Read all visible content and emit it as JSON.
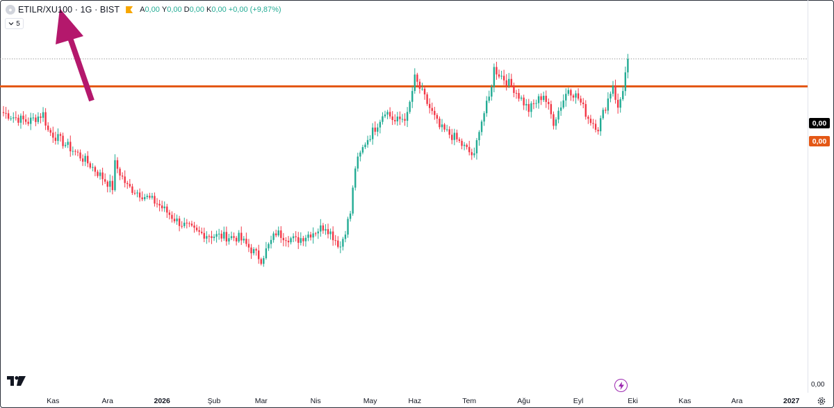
{
  "header": {
    "symbol_title": "ETILR/XU100 · 1G · BIST",
    "ohlc": [
      {
        "key": "A",
        "value": "0,00"
      },
      {
        "key": "Y",
        "value": "0,00"
      },
      {
        "key": "D",
        "value": "0,00"
      },
      {
        "key": "K",
        "value": "0,00"
      }
    ],
    "change": "+0,00 (+9,87%)",
    "indicator_toggle_count": "5"
  },
  "price_scale": {
    "last_price_label": "0,00",
    "hline_label": "0,00",
    "axis_bottom_label": "0,00"
  },
  "colors": {
    "up": "#22ab94",
    "down": "#f23645",
    "hline": "#e45816",
    "arrow": "#b4186c",
    "last_price_tag": "#000000"
  },
  "icons": [
    "tradingview-logo-icon",
    "lightning-bolt-icon",
    "gear-icon",
    "symbol-logo-icon",
    "flag-icon",
    "chevron-down-icon"
  ],
  "chart_data": {
    "type": "candlestick",
    "title": "ETILR/XU100 · 1G · BIST",
    "x_ticks": [
      {
        "label": "Kas",
        "index": 20,
        "bold": false
      },
      {
        "label": "Ara",
        "index": 42,
        "bold": false
      },
      {
        "label": "2026",
        "index": 64,
        "bold": true
      },
      {
        "label": "Şub",
        "index": 85,
        "bold": false
      },
      {
        "label": "Mar",
        "index": 104,
        "bold": false
      },
      {
        "label": "Nis",
        "index": 126,
        "bold": false
      },
      {
        "label": "May",
        "index": 148,
        "bold": false
      },
      {
        "label": "Haz",
        "index": 166,
        "bold": false
      },
      {
        "label": "Tem",
        "index": 188,
        "bold": false
      },
      {
        "label": "Ağu",
        "index": 210,
        "bold": false
      },
      {
        "label": "Eyl",
        "index": 232,
        "bold": false
      },
      {
        "label": "Eki",
        "index": 254,
        "bold": false
      },
      {
        "label": "Kas",
        "index": 275,
        "bold": false
      },
      {
        "label": "Ara",
        "index": 296,
        "bold": false
      },
      {
        "label": "2027",
        "index": 318,
        "bold": true
      }
    ],
    "horizontal_line": {
      "label": "0,00"
    },
    "last_price": {
      "label": "0,00"
    },
    "ylim": [
      0.0,
      0.4
    ],
    "anchors": [
      [
        0,
        0.285
      ],
      [
        5,
        0.28
      ],
      [
        10,
        0.276
      ],
      [
        16,
        0.284
      ],
      [
        18,
        0.267
      ],
      [
        25,
        0.253
      ],
      [
        30,
        0.243
      ],
      [
        35,
        0.232
      ],
      [
        40,
        0.219
      ],
      [
        44,
        0.209
      ],
      [
        45,
        0.233
      ],
      [
        50,
        0.21
      ],
      [
        55,
        0.203
      ],
      [
        62,
        0.193
      ],
      [
        70,
        0.175
      ],
      [
        78,
        0.163
      ],
      [
        85,
        0.16
      ],
      [
        95,
        0.158
      ],
      [
        104,
        0.136
      ],
      [
        110,
        0.163
      ],
      [
        118,
        0.155
      ],
      [
        126,
        0.165
      ],
      [
        130,
        0.17
      ],
      [
        136,
        0.149
      ],
      [
        140,
        0.183
      ],
      [
        142,
        0.23
      ],
      [
        146,
        0.255
      ],
      [
        150,
        0.27
      ],
      [
        154,
        0.288
      ],
      [
        158,
        0.276
      ],
      [
        163,
        0.282
      ],
      [
        166,
        0.32
      ],
      [
        170,
        0.3
      ],
      [
        176,
        0.27
      ],
      [
        182,
        0.26
      ],
      [
        186,
        0.25
      ],
      [
        190,
        0.24
      ],
      [
        192,
        0.27
      ],
      [
        196,
        0.3
      ],
      [
        198,
        0.33
      ],
      [
        202,
        0.32
      ],
      [
        206,
        0.31
      ],
      [
        212,
        0.288
      ],
      [
        218,
        0.304
      ],
      [
        222,
        0.276
      ],
      [
        228,
        0.31
      ],
      [
        232,
        0.3
      ],
      [
        236,
        0.28
      ],
      [
        240,
        0.27
      ],
      [
        246,
        0.314
      ],
      [
        248,
        0.288
      ],
      [
        250,
        0.31
      ],
      [
        252,
        0.34
      ]
    ]
  }
}
